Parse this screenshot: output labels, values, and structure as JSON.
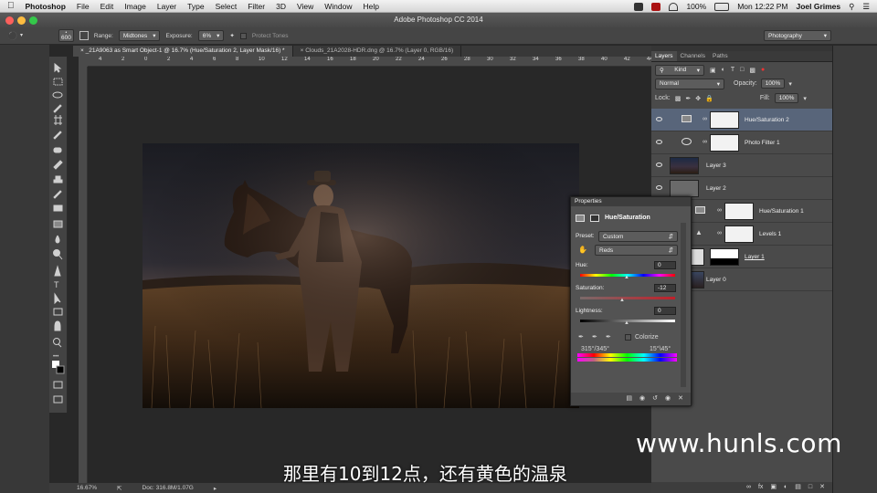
{
  "menubar": {
    "apple": "",
    "app": "Photoshop",
    "items": [
      "File",
      "Edit",
      "Image",
      "Layer",
      "Type",
      "Select",
      "Filter",
      "3D",
      "View",
      "Window",
      "Help"
    ],
    "battery": "100%",
    "clock": "Mon 12:22 PM",
    "user": "Joel Grimes"
  },
  "window": {
    "title": "Adobe Photoshop CC 2014"
  },
  "options": {
    "brush_size": "600",
    "range_label": "Range:",
    "range_value": "Midtones",
    "exposure_label": "Exposure:",
    "exposure_value": "6%",
    "protect_tones": "Protect Tones",
    "workspace": "Photography"
  },
  "tabs": [
    {
      "label": "_21A9063 as Smart Object-1 @ 16.7% (Hue/Saturation 2, Layer Mask/16) *"
    },
    {
      "label": "Clouds_21A2028-HDR.dng @ 16.7% (Layer 0, RGB/16)"
    }
  ],
  "ruler": {
    "ticks": [
      "4",
      "2",
      "0",
      "2",
      "4",
      "6",
      "8",
      "10",
      "12",
      "14",
      "16",
      "18",
      "20",
      "22",
      "24",
      "26",
      "28",
      "30",
      "32",
      "34",
      "36",
      "38",
      "40",
      "42",
      "44"
    ]
  },
  "status": {
    "zoom": "16.67%",
    "doc": "Doc: 316.8M/1.07G"
  },
  "layers_panel": {
    "tabs": [
      "Layers",
      "Channels",
      "Paths"
    ],
    "filter": "Kind",
    "blend_mode": "Normal",
    "opacity_label": "Opacity:",
    "opacity": "100%",
    "lock_label": "Lock:",
    "fill_label": "Fill:",
    "fill": "100%",
    "layers": [
      {
        "name": "Hue/Saturation 2"
      },
      {
        "name": "Photo Filter 1"
      },
      {
        "name": "Layer 3"
      },
      {
        "name": "Layer 2"
      },
      {
        "name": "Hue/Saturation 1"
      },
      {
        "name": "Levels 1"
      },
      {
        "name": "Layer 1"
      },
      {
        "name": "Layer 0"
      }
    ]
  },
  "properties": {
    "title": "Properties",
    "adjustment": "Hue/Saturation",
    "preset_label": "Preset:",
    "preset": "Custom",
    "channel": "Reds",
    "hue_label": "Hue:",
    "hue": "0",
    "saturation_label": "Saturation:",
    "saturation": "-12",
    "lightness_label": "Lightness:",
    "lightness": "0",
    "colorize": "Colorize",
    "range_left": "315°/345°",
    "range_right": "15°\\45°"
  },
  "watermark": "www.hunls.com",
  "subtitle": "那里有10到12点，还有黄色的温泉",
  "colors": {
    "ui_dark": "#282828",
    "panel": "#4a4a4a",
    "selected_layer": "#58657a"
  }
}
